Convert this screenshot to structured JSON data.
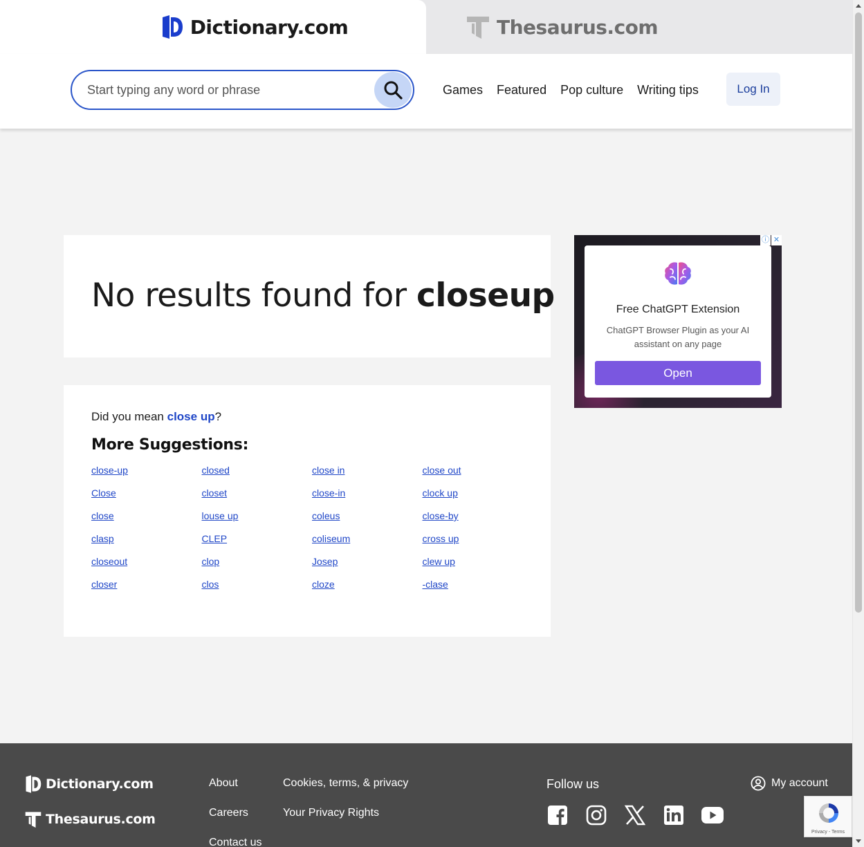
{
  "header": {
    "dictionary_brand": "Dictionary.com",
    "thesaurus_brand": "Thesaurus.com"
  },
  "search": {
    "placeholder": "Start typing any word or phrase"
  },
  "nav": {
    "items": [
      "Games",
      "Featured",
      "Pop culture",
      "Writing tips"
    ],
    "login_label": "Log In"
  },
  "results": {
    "prefix": "No results found for ",
    "query": "closeup"
  },
  "suggestions": {
    "did_you_mean_prefix": "Did you mean ",
    "did_you_mean_term": "close up",
    "did_you_mean_suffix": "?",
    "more_title": "More Suggestions:",
    "columns": [
      [
        "close-up",
        "Close",
        "close",
        "clasp",
        "closeout",
        "closer"
      ],
      [
        "closed",
        "closet",
        "louse up",
        "CLEP",
        "clop",
        "clos"
      ],
      [
        "close in",
        "close-in",
        "coleus",
        "coliseum",
        "Josep",
        "cloze"
      ],
      [
        "close out",
        "clock up",
        "close-by",
        "cross up",
        "clew up",
        "-clase"
      ]
    ]
  },
  "ad": {
    "title": "Free ChatGPT Extension",
    "description": "ChatGPT Browser Plugin as your AI assistant on any page",
    "button_label": "Open",
    "info_glyph": "ⓘ",
    "close_glyph": "✕",
    "button_color": "#7a57e0"
  },
  "footer": {
    "dictionary_brand": "Dictionary.com",
    "thesaurus_brand": "Thesaurus.com",
    "links_col1": [
      "About",
      "Careers",
      "Contact us"
    ],
    "links_col2": [
      "Cookies, terms, & privacy",
      "Your Privacy Rights"
    ],
    "follow_label": "Follow us",
    "social": [
      "facebook-icon",
      "instagram-icon",
      "x-icon",
      "linkedin-icon",
      "youtube-icon"
    ],
    "account_label": "My account"
  },
  "recaptcha": {
    "text": "Privacy - Terms"
  },
  "colors": {
    "brand_blue": "#1f46c7",
    "search_border": "#2a55c9",
    "footer_bg": "#4a4a4a"
  }
}
